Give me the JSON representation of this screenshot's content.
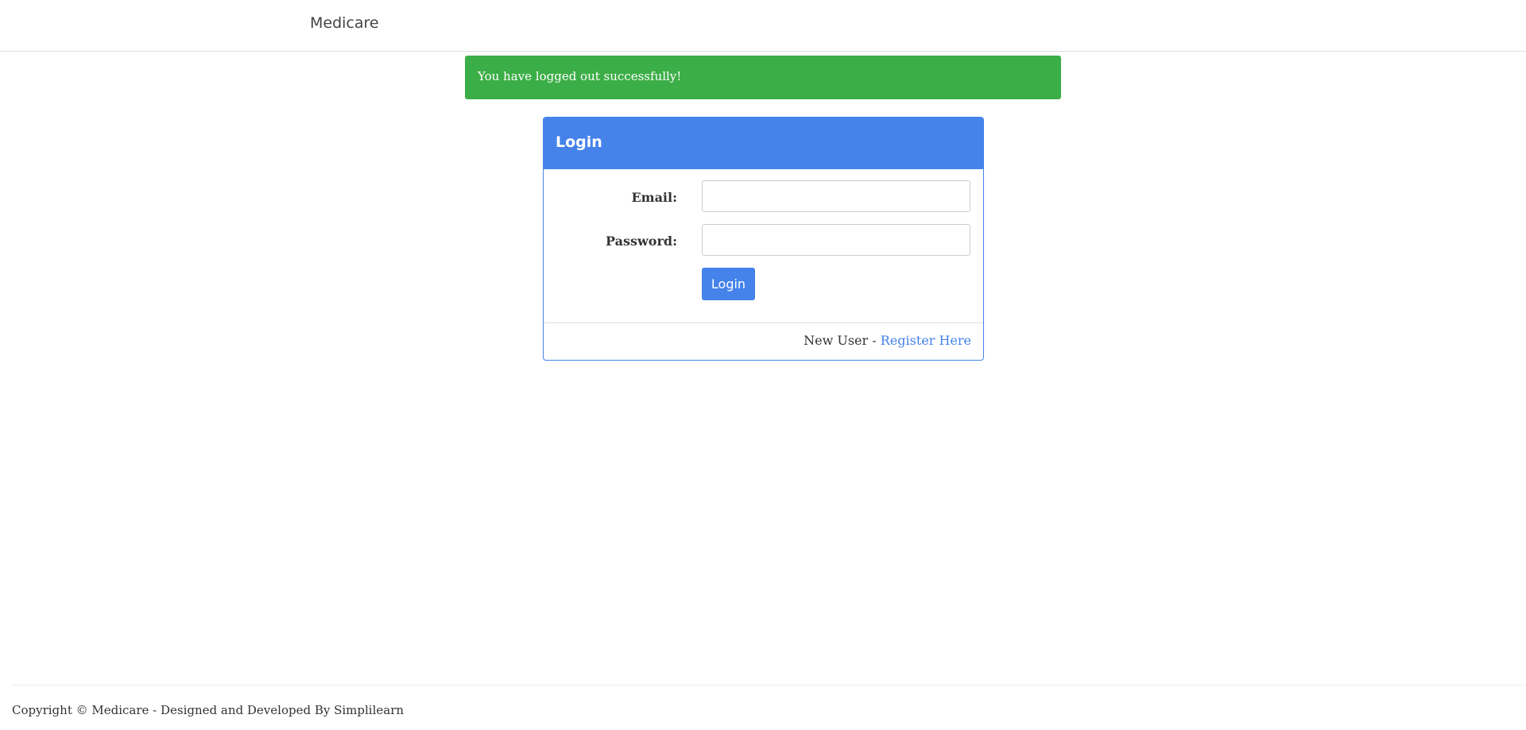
{
  "navbar": {
    "brand": "Medicare"
  },
  "alert": {
    "message": "You have logged out successfully!",
    "color": "#3cae47"
  },
  "login_panel": {
    "title": "Login",
    "accent_color": "#4582ea",
    "email_label": "Email:",
    "email_value": "",
    "password_label": "Password:",
    "password_value": "",
    "submit_label": "Login",
    "footer_text": "New User - ",
    "register_link": "Register Here"
  },
  "footer": {
    "copyright": "Copyright © Medicare - Designed and Developed By Simplilearn"
  }
}
